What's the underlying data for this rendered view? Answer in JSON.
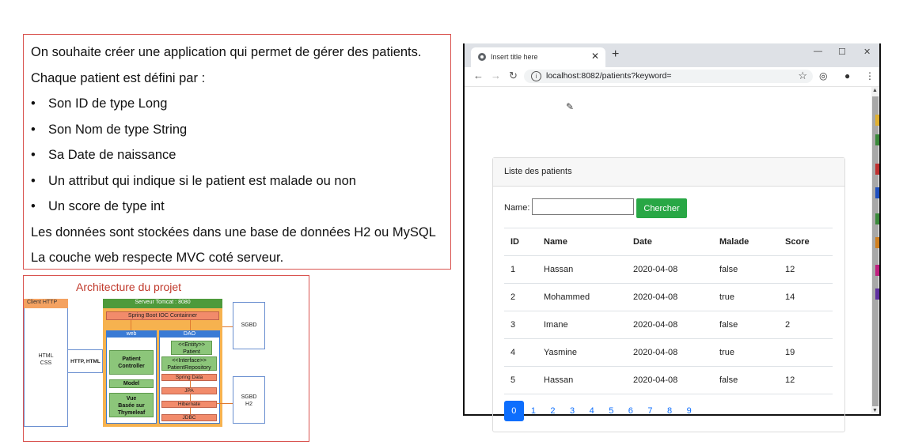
{
  "spec": {
    "intro": "On souhaite créer une application qui permet de gérer des patients.",
    "defined_by": "Chaque patient est défini par :",
    "bullets": [
      "Son ID de type Long",
      "Son Nom de type String",
      "Sa Date de naissance",
      "Un attribut qui indique si le patient est malade ou non",
      "Un score de type int"
    ],
    "storage": "Les données sont stockées dans une base de données H2 ou MySQL",
    "mvc": "La couche web respecte MVC coté serveur."
  },
  "architecture": {
    "title": "Architecture du projet",
    "client_http": "Client HTTP",
    "html_css_1": "HTML",
    "html_css_2": "CSS",
    "protocol": "HTTP, HTML",
    "tomcat": "Serveur Tomcat : 8080",
    "spring_container": "Spring Boot IOC Containner",
    "web_label": "web",
    "dao_label": "DAO",
    "patient_controller_1": "Patient",
    "patient_controller_2": "Controller",
    "model": "Model",
    "vue_1": "Vue",
    "vue_2": "Basée sur",
    "vue_3": "Thymeleaf",
    "entity_1": "<<Entity>>",
    "entity_2": "Patient",
    "repo_1": "<<Interface>>",
    "repo_2": "PatientRepository",
    "spring_data": "Spring Data",
    "jpa": "JPA",
    "hibernate": "Hibernate",
    "jdbc": "JDBC",
    "sgbd_1": "SGBD",
    "sgbd_2": "SGBD",
    "sgbd_2_sub": "H2"
  },
  "browser": {
    "tab_title": "Insert title here",
    "url": "localhost:8082/patients?keyword=",
    "card_title": "Liste des patients",
    "search_label": "Name:",
    "search_value": "",
    "search_button": "Chercher",
    "columns": [
      "ID",
      "Name",
      "Date",
      "Malade",
      "Score"
    ],
    "rows": [
      [
        "1",
        "Hassan",
        "2020-04-08",
        "false",
        "12"
      ],
      [
        "2",
        "Mohammed",
        "2020-04-08",
        "true",
        "14"
      ],
      [
        "3",
        "Imane",
        "2020-04-08",
        "false",
        "2"
      ],
      [
        "4",
        "Yasmine",
        "2020-04-08",
        "true",
        "19"
      ],
      [
        "5",
        "Hassan",
        "2020-04-08",
        "false",
        "12"
      ]
    ],
    "pages": [
      "0",
      "1",
      "2",
      "3",
      "4",
      "5",
      "6",
      "7",
      "8",
      "9"
    ],
    "current_page": "0",
    "accent_color": "#0d6efd",
    "button_color": "#28a745"
  },
  "icons": {
    "back": "arrow-left-icon",
    "forward": "arrow-right-icon",
    "reload": "reload-icon",
    "info": "info-icon",
    "star": "star-icon",
    "pencil": "pencil-icon",
    "profile": "profile-icon",
    "menu": "kebab-menu-icon"
  }
}
